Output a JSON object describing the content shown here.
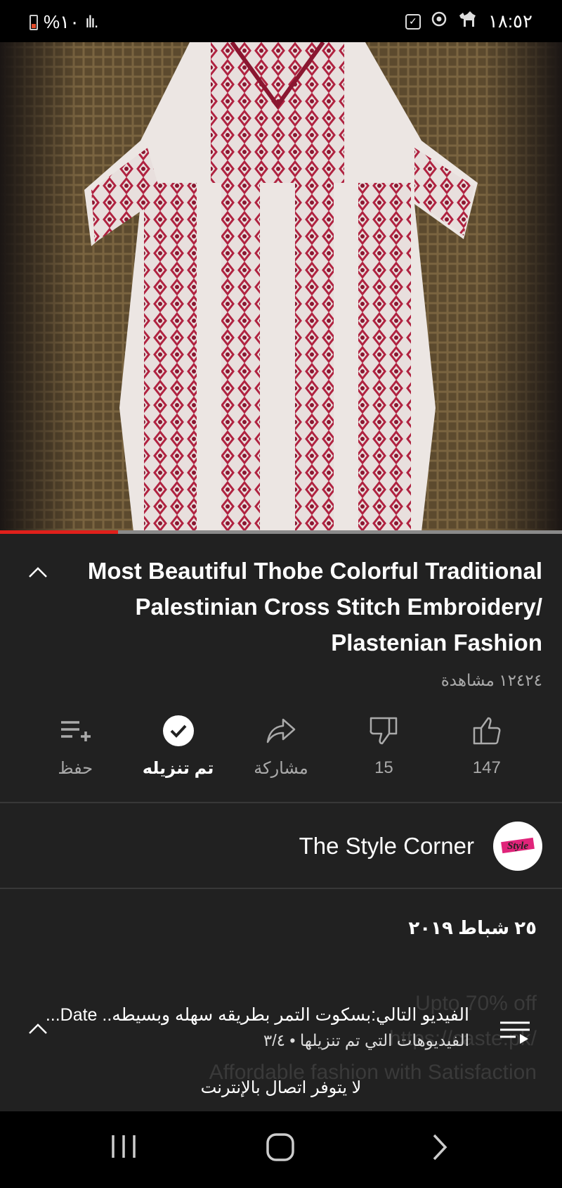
{
  "status_bar": {
    "battery": "%١٠",
    "signal": "ılı.",
    "time": "١٨:٥٢"
  },
  "video": {
    "progress": 0.21,
    "colors": {
      "progress_fill": "#e0201b",
      "embroidery": "#b02240",
      "fabric": "#ece6e3"
    }
  },
  "title": "Most Beautiful Thobe Colorful Traditional Palestinian Cross Stitch Embroidery/ Plastenian Fashion",
  "views": "١٢٤٢٤ مشاهدة",
  "actions": {
    "like_count": "147",
    "dislike_count": "15",
    "share_label": "مشاركة",
    "download_label": "تم تنزيله",
    "save_label": "حفظ"
  },
  "channel": {
    "name": "The Style Corner",
    "avatar_text": "Style"
  },
  "date": "٢٥ شباط ٢٠١٩",
  "background_text": {
    "line1": "Upto 70% off",
    "line2": "https://caste.pk/",
    "line3": "Affordable fashion with Satisfaction"
  },
  "up_next": {
    "title": "الفيديو التالي:بسكوت التمر  بطريقه سهله وبسيطه.. Date...",
    "subtitle": "الفيديوهات التي تم تنزيلها • ٣/٤"
  },
  "offline_message": "لا يتوفر اتصال بالإنترنت",
  "icons": {
    "collapse": "chevron-up-icon",
    "like": "thumbs-up-icon",
    "dislike": "thumbs-down-icon",
    "share": "share-icon",
    "download": "check-circle-icon",
    "save": "playlist-add-icon",
    "playlist": "playlist-icon"
  }
}
